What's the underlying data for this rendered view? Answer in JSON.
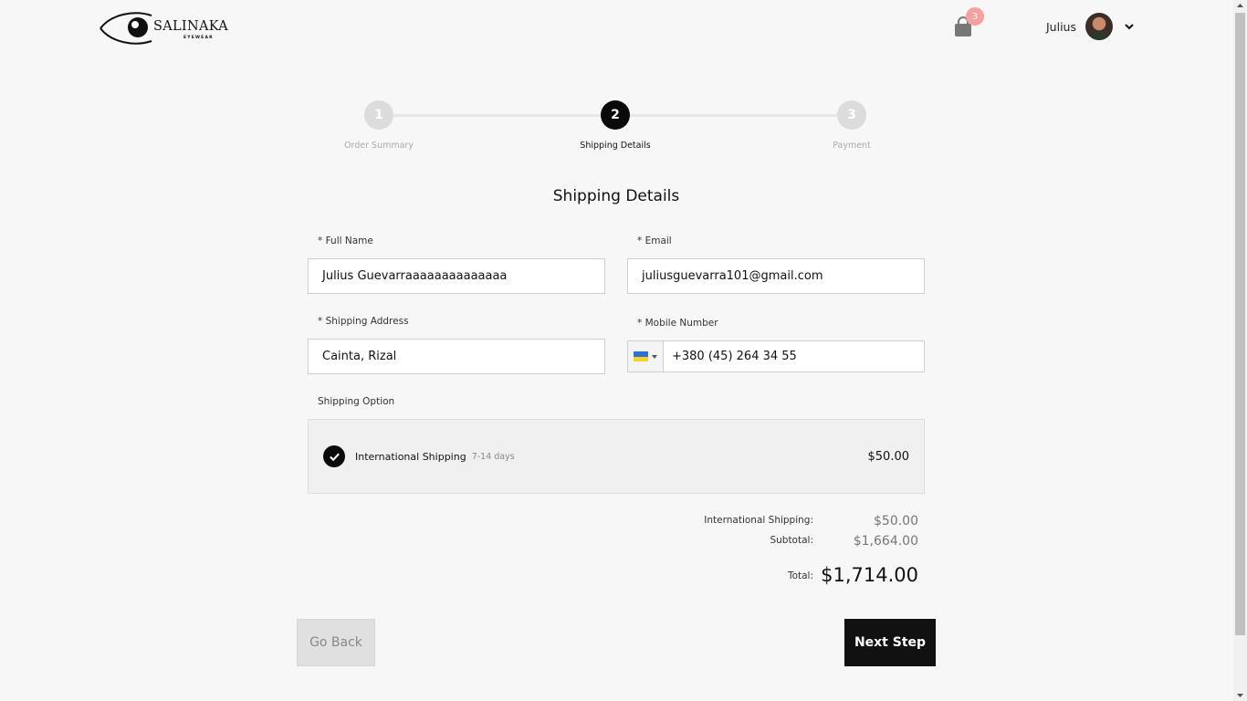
{
  "brand": {
    "name": "SALINAKA",
    "tagline": "EYEWEAR"
  },
  "header": {
    "cart_icon": "shopping-bag-icon",
    "cart_count": "3",
    "user_name": "Julius",
    "user_menu_icon": "chevron-down-icon"
  },
  "stepper": {
    "steps": [
      {
        "number": "1",
        "label": "Order Summary",
        "state": "inactive"
      },
      {
        "number": "2",
        "label": "Shipping Details",
        "state": "active"
      },
      {
        "number": "3",
        "label": "Payment",
        "state": "inactive"
      }
    ]
  },
  "form": {
    "title": "Shipping Details",
    "full_name": {
      "label": "* Full Name",
      "value": "Julius Guevarraaaaaaaaaaaaaa"
    },
    "email": {
      "label": "* Email",
      "value": "juliusguevarra101@gmail.com"
    },
    "address": {
      "label": "* Shipping Address",
      "value": "Cainta, Rizal"
    },
    "mobile": {
      "label": "* Mobile Number",
      "value": "+380 (45) 264 34 55",
      "country_flag": "ukraine-flag-icon"
    },
    "shipping_option": {
      "label": "Shipping Option",
      "name": "International Shipping",
      "days": "7-14 days",
      "price": "$50.00",
      "selected": true
    }
  },
  "summary": {
    "shipping_label": "International Shipping:",
    "shipping_value": "$50.00",
    "subtotal_label": "Subtotal:",
    "subtotal_value": "$1,664.00",
    "total_label": "Total:",
    "total_value": "$1,714.00"
  },
  "actions": {
    "back_label": "Go Back",
    "next_label": "Next Step"
  },
  "colors": {
    "background": "#f7f7f7",
    "primary": "#0a0a0a",
    "badge": "#f7a0a0",
    "inactive_step": "#dcdcdc"
  }
}
